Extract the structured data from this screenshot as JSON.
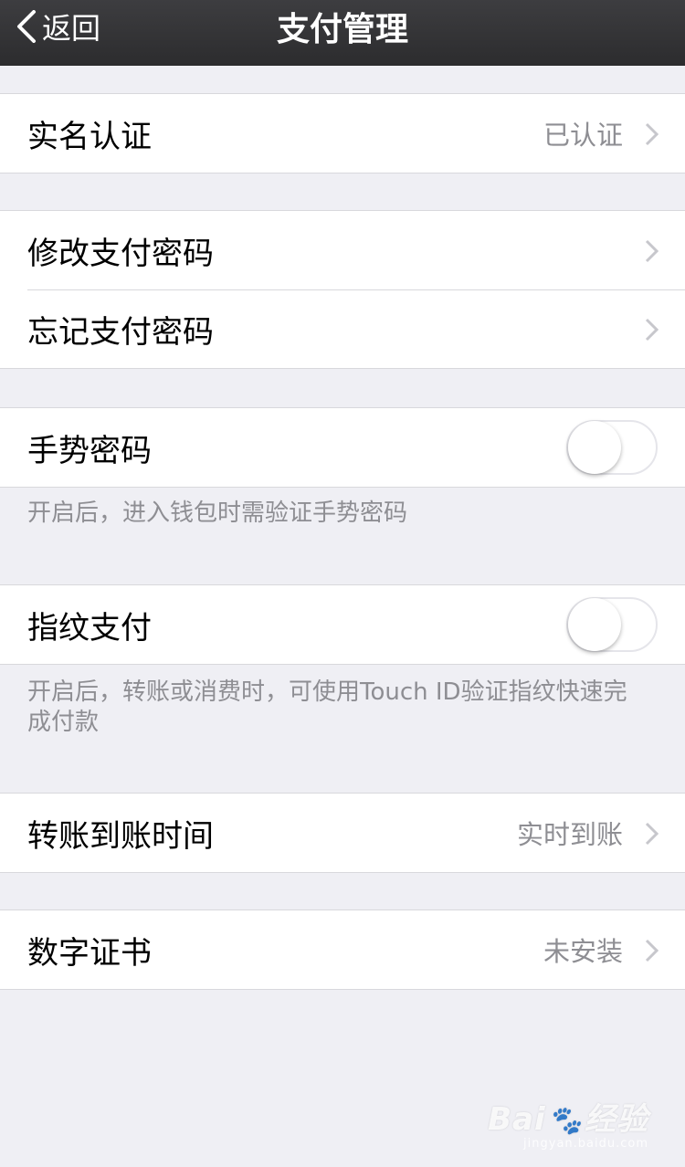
{
  "nav": {
    "back_label": "返回",
    "title": "支付管理"
  },
  "rows": {
    "real_name": {
      "label": "实名认证",
      "value": "已认证"
    },
    "change_pwd": {
      "label": "修改支付密码"
    },
    "forgot_pwd": {
      "label": "忘记支付密码"
    },
    "gesture": {
      "label": "手势密码",
      "enabled": false,
      "footnote": "开启后，进入钱包时需验证手势密码"
    },
    "fingerprint": {
      "label": "指纹支付",
      "enabled": false,
      "footnote": "开启后，转账或消费时，可使用Touch ID验证指纹快速完成付款"
    },
    "transfer_time": {
      "label": "转账到账时间",
      "value": "实时到账"
    },
    "certificate": {
      "label": "数字证书",
      "value": "未安装"
    }
  },
  "watermark": {
    "logo": "Bai",
    "logo_suffix": "经验",
    "sub": "jingyan.baidu.com"
  },
  "colors": {
    "background": "#efeff4",
    "navbar": "#333335",
    "secondary_text": "#8e8e93",
    "separator": "#d8d8dc"
  },
  "icons": [
    "back-chevron-icon",
    "chevron-right-icon",
    "baidu-paw-icon"
  ]
}
